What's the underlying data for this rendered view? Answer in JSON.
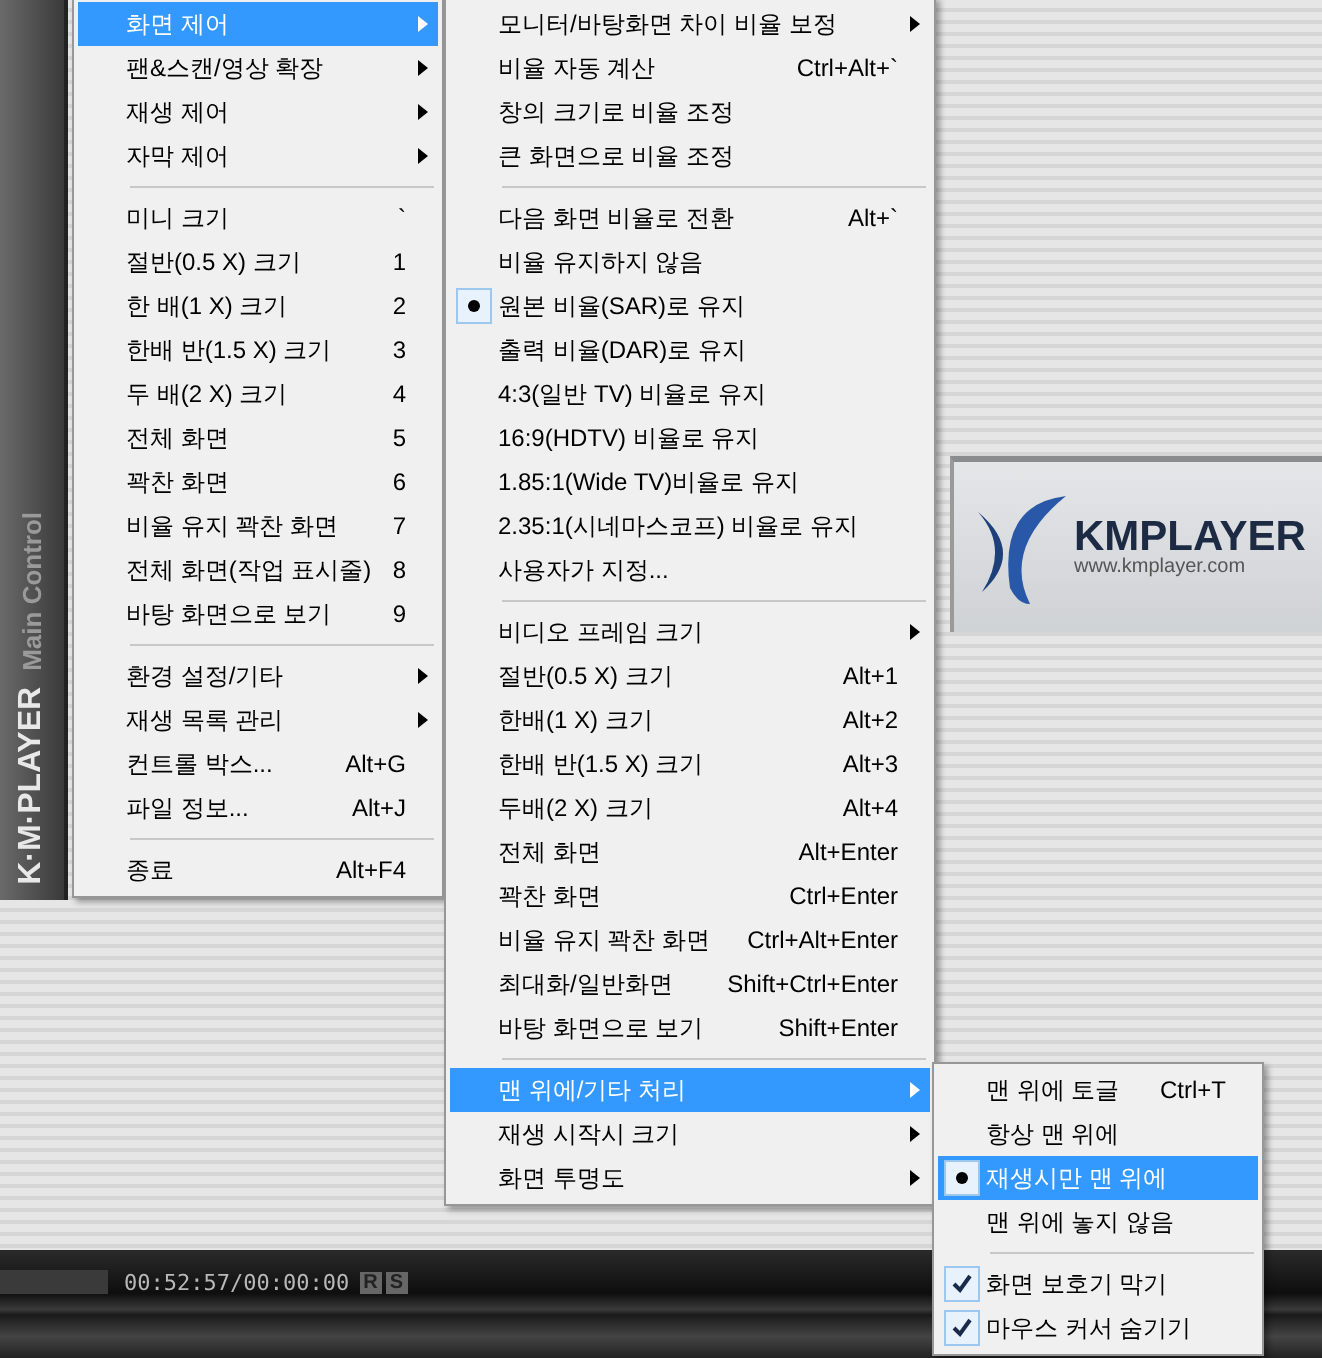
{
  "player": {
    "side_title": "K·M·PLAYER",
    "side_subtitle": "Main Control",
    "logo": {
      "name": "KMPLAYER",
      "url": "www.kmplayer.com"
    },
    "time": "00:52:57/00:00:00",
    "badges": [
      "R",
      "S"
    ]
  },
  "menus": [
    {
      "items": [
        {
          "kind": "command",
          "label": "화면 제어",
          "submenu": true,
          "selected": true
        },
        {
          "kind": "command",
          "label": "팬&스캔/영상 확장",
          "submenu": true,
          "selected": false
        },
        {
          "kind": "command",
          "label": "재생 제어",
          "submenu": true,
          "selected": false
        },
        {
          "kind": "command",
          "label": "자막 제어",
          "submenu": true,
          "selected": false
        },
        {
          "kind": "separator"
        },
        {
          "kind": "command",
          "label": "미니 크기",
          "shortcut": "`",
          "submenu": false,
          "selected": false
        },
        {
          "kind": "command",
          "label": "절반(0.5 X) 크기",
          "shortcut": "1",
          "submenu": false,
          "selected": false
        },
        {
          "kind": "command",
          "label": "한 배(1 X) 크기",
          "shortcut": "2",
          "submenu": false,
          "selected": false
        },
        {
          "kind": "command",
          "label": "한배 반(1.5 X) 크기",
          "shortcut": "3",
          "submenu": false,
          "selected": false
        },
        {
          "kind": "command",
          "label": "두 배(2 X) 크기",
          "shortcut": "4",
          "submenu": false,
          "selected": false
        },
        {
          "kind": "command",
          "label": "전체 화면",
          "shortcut": "5",
          "submenu": false,
          "selected": false
        },
        {
          "kind": "command",
          "label": "꽉찬 화면",
          "shortcut": "6",
          "submenu": false,
          "selected": false
        },
        {
          "kind": "command",
          "label": "비율 유지 꽉찬 화면",
          "shortcut": "7",
          "submenu": false,
          "selected": false
        },
        {
          "kind": "command",
          "label": "전체 화면(작업 표시줄)",
          "shortcut": "8",
          "submenu": false,
          "selected": false
        },
        {
          "kind": "command",
          "label": "바탕 화면으로 보기",
          "shortcut": "9",
          "submenu": false,
          "selected": false
        },
        {
          "kind": "separator"
        },
        {
          "kind": "command",
          "label": "환경 설정/기타",
          "submenu": true,
          "selected": false
        },
        {
          "kind": "command",
          "label": "재생 목록 관리",
          "submenu": true,
          "selected": false
        },
        {
          "kind": "command",
          "label": "컨트롤 박스...",
          "shortcut": "Alt+G",
          "submenu": false,
          "selected": false
        },
        {
          "kind": "command",
          "label": "파일 정보...",
          "shortcut": "Alt+J",
          "submenu": false,
          "selected": false
        },
        {
          "kind": "separator"
        },
        {
          "kind": "command",
          "label": "종료",
          "shortcut": "Alt+F4",
          "submenu": false,
          "selected": false
        }
      ]
    },
    {
      "items": [
        {
          "kind": "command",
          "label": "모니터/바탕화면 차이 비율 보정",
          "submenu": true,
          "selected": false
        },
        {
          "kind": "command",
          "label": "비율 자동 계산",
          "shortcut": "Ctrl+Alt+`",
          "submenu": false,
          "selected": false
        },
        {
          "kind": "command",
          "label": "창의 크기로 비율 조정",
          "submenu": false,
          "selected": false
        },
        {
          "kind": "command",
          "label": "큰 화면으로 비율 조정",
          "submenu": false,
          "selected": false
        },
        {
          "kind": "separator"
        },
        {
          "kind": "command",
          "label": "다음 화면 비율로 전환",
          "shortcut": "Alt+`",
          "submenu": false,
          "selected": false
        },
        {
          "kind": "radio",
          "label": "비율 유지하지 않음",
          "submenu": false,
          "selected": false,
          "checked": false
        },
        {
          "kind": "radio",
          "label": "원본 비율(SAR)로 유지",
          "submenu": false,
          "selected": false,
          "checked": true
        },
        {
          "kind": "radio",
          "label": "출력 비율(DAR)로 유지",
          "submenu": false,
          "selected": false,
          "checked": false
        },
        {
          "kind": "radio",
          "label": "4:3(일반 TV) 비율로 유지",
          "submenu": false,
          "selected": false,
          "checked": false
        },
        {
          "kind": "radio",
          "label": "16:9(HDTV) 비율로 유지",
          "submenu": false,
          "selected": false,
          "checked": false
        },
        {
          "kind": "radio",
          "label": "1.85:1(Wide TV)비율로 유지",
          "submenu": false,
          "selected": false,
          "checked": false
        },
        {
          "kind": "radio",
          "label": "2.35:1(시네마스코프) 비율로 유지",
          "submenu": false,
          "selected": false,
          "checked": false
        },
        {
          "kind": "radio",
          "label": "사용자가 지정...",
          "submenu": false,
          "selected": false,
          "checked": false
        },
        {
          "kind": "separator"
        },
        {
          "kind": "command",
          "label": "비디오 프레임 크기",
          "submenu": true,
          "selected": false
        },
        {
          "kind": "command",
          "label": "절반(0.5 X) 크기",
          "shortcut": "Alt+1",
          "submenu": false,
          "selected": false
        },
        {
          "kind": "command",
          "label": "한배(1 X) 크기",
          "shortcut": "Alt+2",
          "submenu": false,
          "selected": false
        },
        {
          "kind": "command",
          "label": "한배 반(1.5 X) 크기",
          "shortcut": "Alt+3",
          "submenu": false,
          "selected": false
        },
        {
          "kind": "command",
          "label": "두배(2 X) 크기",
          "shortcut": "Alt+4",
          "submenu": false,
          "selected": false
        },
        {
          "kind": "command",
          "label": "전체 화면",
          "shortcut": "Alt+Enter",
          "submenu": false,
          "selected": false
        },
        {
          "kind": "command",
          "label": "꽉찬 화면",
          "shortcut": "Ctrl+Enter",
          "submenu": false,
          "selected": false
        },
        {
          "kind": "command",
          "label": "비율 유지 꽉찬 화면",
          "shortcut": "Ctrl+Alt+Enter",
          "submenu": false,
          "selected": false
        },
        {
          "kind": "command",
          "label": "최대화/일반화면",
          "shortcut": "Shift+Ctrl+Enter",
          "submenu": false,
          "selected": false
        },
        {
          "kind": "command",
          "label": "바탕 화면으로 보기",
          "shortcut": "Shift+Enter",
          "submenu": false,
          "selected": false
        },
        {
          "kind": "separator"
        },
        {
          "kind": "command",
          "label": "맨 위에/기타 처리",
          "submenu": true,
          "selected": true
        },
        {
          "kind": "command",
          "label": "재생 시작시 크기",
          "submenu": true,
          "selected": false
        },
        {
          "kind": "command",
          "label": "화면 투명도",
          "submenu": true,
          "selected": false
        }
      ]
    },
    {
      "items": [
        {
          "kind": "radio",
          "label": "맨 위에 토글",
          "shortcut": "Ctrl+T",
          "submenu": false,
          "selected": false,
          "checked": false
        },
        {
          "kind": "radio",
          "label": "항상 맨 위에",
          "submenu": false,
          "selected": false,
          "checked": false
        },
        {
          "kind": "radio",
          "label": "재생시만 맨 위에",
          "submenu": false,
          "selected": true,
          "checked": true
        },
        {
          "kind": "radio",
          "label": "맨 위에 놓지 않음",
          "submenu": false,
          "selected": false,
          "checked": false
        },
        {
          "kind": "separator"
        },
        {
          "kind": "check",
          "label": "화면 보호기 막기",
          "submenu": false,
          "selected": false,
          "checked": true
        },
        {
          "kind": "check",
          "label": "마우스 커서 숨기기",
          "submenu": false,
          "selected": false,
          "checked": true
        }
      ]
    }
  ]
}
